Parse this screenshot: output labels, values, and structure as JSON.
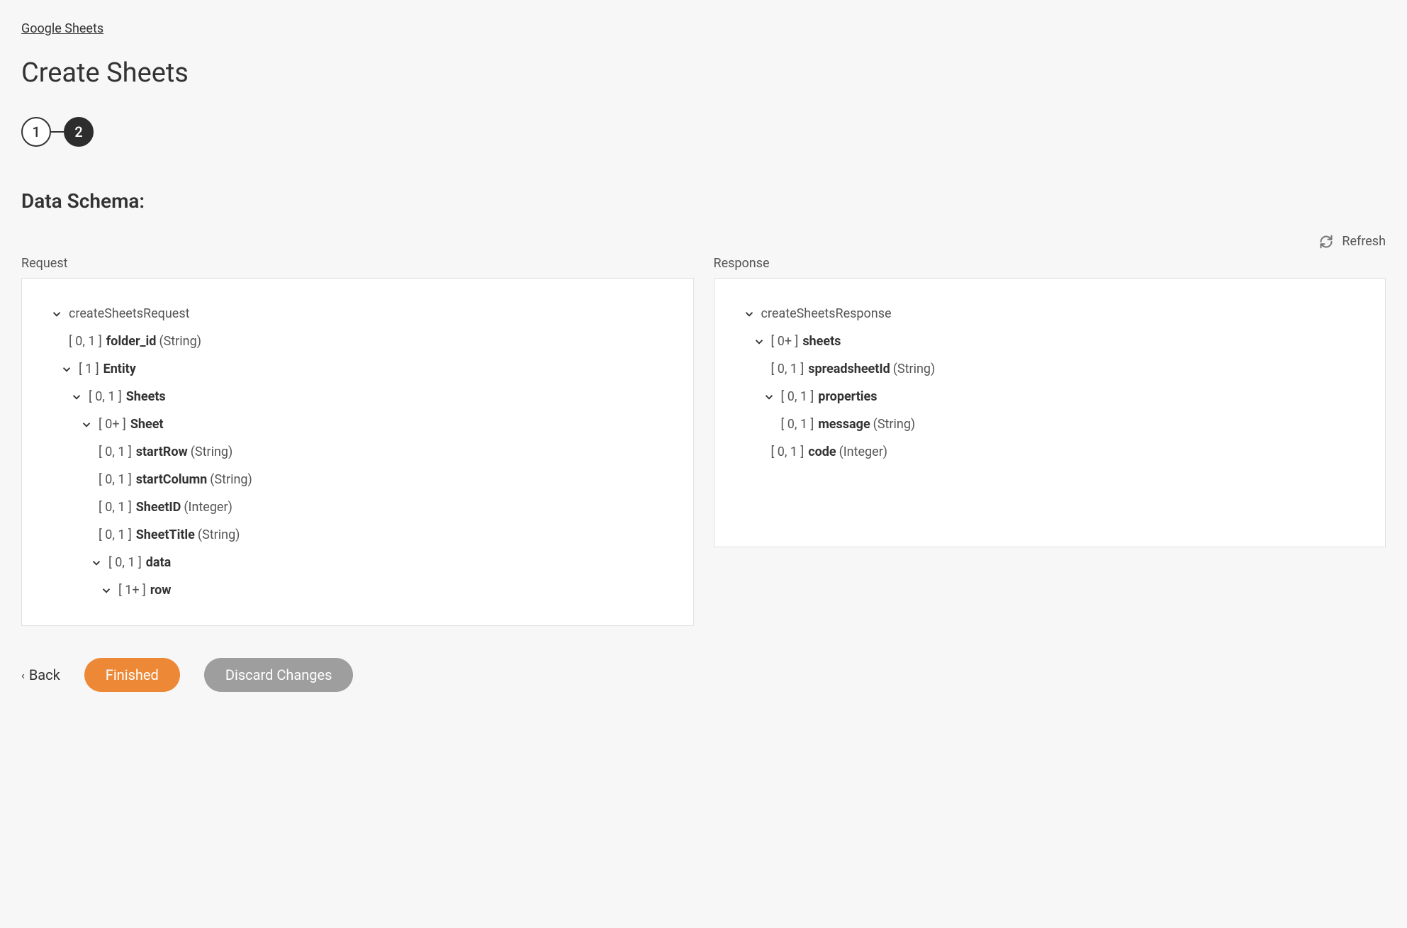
{
  "breadcrumb": "Google Sheets",
  "pageTitle": "Create Sheets",
  "stepper": {
    "step1": "1",
    "step2": "2"
  },
  "sectionTitle": "Data Schema:",
  "refresh": "Refresh",
  "requestLabel": "Request",
  "responseLabel": "Response",
  "request": {
    "root": "createSheetsRequest",
    "folder_id": {
      "card": "[ 0, 1 ]",
      "name": "folder_id",
      "type": "(String)"
    },
    "entity": {
      "card": "[ 1 ]",
      "name": "Entity"
    },
    "sheets": {
      "card": "[ 0, 1 ]",
      "name": "Sheets"
    },
    "sheet": {
      "card": "[ 0+ ]",
      "name": "Sheet"
    },
    "startRow": {
      "card": "[ 0, 1 ]",
      "name": "startRow",
      "type": "(String)"
    },
    "startCol": {
      "card": "[ 0, 1 ]",
      "name": "startColumn",
      "type": "(String)"
    },
    "sheetId": {
      "card": "[ 0, 1 ]",
      "name": "SheetID",
      "type": "(Integer)"
    },
    "sheetTitle": {
      "card": "[ 0, 1 ]",
      "name": "SheetTitle",
      "type": "(String)"
    },
    "data": {
      "card": "[ 0, 1 ]",
      "name": "data"
    },
    "row": {
      "card": "[ 1+ ]",
      "name": "row"
    }
  },
  "response": {
    "root": "createSheetsResponse",
    "sheets": {
      "card": "[ 0+ ]",
      "name": "sheets"
    },
    "spreadsheetId": {
      "card": "[ 0, 1 ]",
      "name": "spreadsheetId",
      "type": "(String)"
    },
    "properties": {
      "card": "[ 0, 1 ]",
      "name": "properties"
    },
    "message": {
      "card": "[ 0, 1 ]",
      "name": "message",
      "type": "(String)"
    },
    "code": {
      "card": "[ 0, 1 ]",
      "name": "code",
      "type": "(Integer)"
    }
  },
  "footer": {
    "back": "Back",
    "finished": "Finished",
    "discard": "Discard Changes"
  }
}
